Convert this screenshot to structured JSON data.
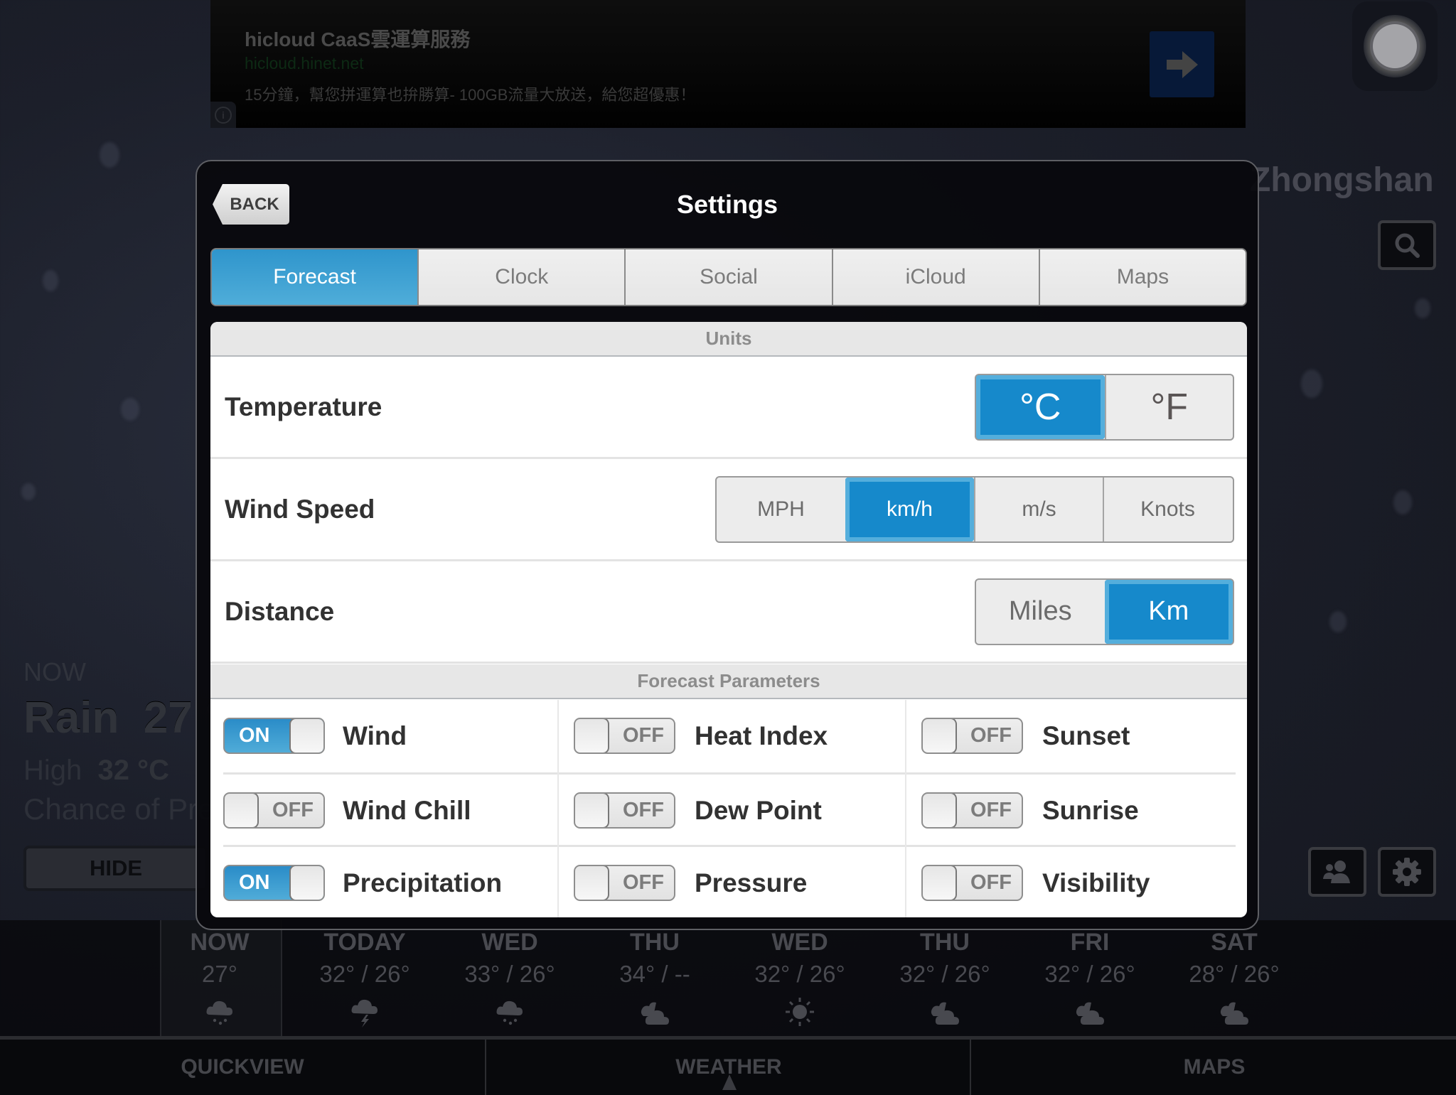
{
  "ad": {
    "title": "hicloud CaaS雲運算服務",
    "url": "hicloud.hinet.net",
    "body": "15分鐘，幫您拼運算也拚勝算- 100GB流量大放送，給您超優惠！",
    "go_icon": "arrow-right-icon",
    "info_icon": "info-icon",
    "info_glyph": "i"
  },
  "background": {
    "city": "Zhongshan",
    "now_label": "NOW",
    "condition": "Rain",
    "current_temp": "27",
    "current_unit": "°",
    "high_label": "High",
    "high_value": "32 °C",
    "chance_text": "Chance of Pre",
    "hide_label": "HIDE"
  },
  "forecast": [
    {
      "day": "NOW",
      "temp": "27°",
      "icon": "rain"
    },
    {
      "day": "TODAY",
      "temp": "32° / 26°",
      "icon": "thunderstorm"
    },
    {
      "day": "WED",
      "temp": "33° / 26°",
      "icon": "rain"
    },
    {
      "day": "THU",
      "temp": "34° / --",
      "icon": "cloudy"
    },
    {
      "day": "WED",
      "temp": "32° / 26°",
      "icon": "sunny"
    },
    {
      "day": "THU",
      "temp": "32° / 26°",
      "icon": "cloudy"
    },
    {
      "day": "FRI",
      "temp": "32° / 26°",
      "icon": "cloudy"
    },
    {
      "day": "SAT",
      "temp": "28° / 26°",
      "icon": "cloudy"
    }
  ],
  "bottom_tabs": [
    {
      "label": "QUICKVIEW",
      "active": false
    },
    {
      "label": "WEATHER",
      "active": true
    },
    {
      "label": "MAPS",
      "active": false
    }
  ],
  "settings": {
    "title": "Settings",
    "back_label": "BACK",
    "tabs": [
      {
        "label": "Forecast",
        "active": true
      },
      {
        "label": "Clock",
        "active": false
      },
      {
        "label": "Social",
        "active": false
      },
      {
        "label": "iCloud",
        "active": false
      },
      {
        "label": "Maps",
        "active": false
      }
    ],
    "units_header": "Units",
    "units": {
      "temperature": {
        "label": "Temperature",
        "options": [
          "°C",
          "°F"
        ],
        "selected": "°C"
      },
      "wind_speed": {
        "label": "Wind Speed",
        "options": [
          "MPH",
          "km/h",
          "m/s",
          "Knots"
        ],
        "selected": "km/h"
      },
      "distance": {
        "label": "Distance",
        "options": [
          "Miles",
          "Km"
        ],
        "selected": "Km"
      }
    },
    "forecast_params_header": "Forecast Parameters",
    "on_label": "ON",
    "off_label": "OFF",
    "params": [
      [
        {
          "label": "Wind",
          "on": true
        },
        {
          "label": "Wind Chill",
          "on": false
        },
        {
          "label": "Precipitation",
          "on": true
        }
      ],
      [
        {
          "label": "Heat Index",
          "on": false
        },
        {
          "label": "Dew Point",
          "on": false
        },
        {
          "label": "Pressure",
          "on": false
        }
      ],
      [
        {
          "label": "Sunset",
          "on": false
        },
        {
          "label": "Sunrise",
          "on": false
        },
        {
          "label": "Visibility",
          "on": false
        }
      ]
    ]
  },
  "colors": {
    "accent": "#1689cb",
    "accent_light": "#54aedc"
  }
}
